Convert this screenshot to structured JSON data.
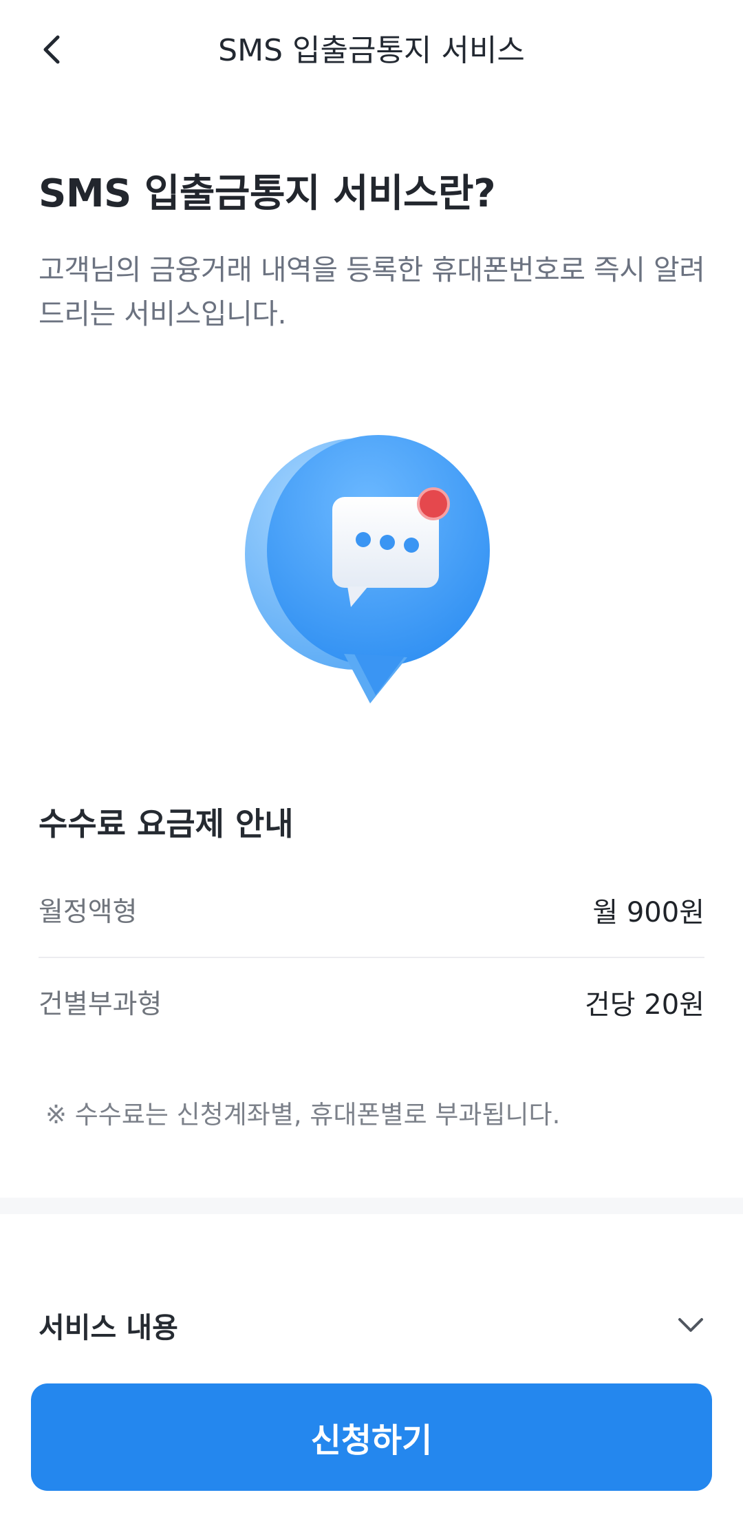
{
  "header": {
    "title": "SMS 입출금통지 서비스",
    "back_icon": "chevron-left-icon"
  },
  "hero": {
    "title": "SMS 입출금통지 서비스란?",
    "description": "고객님의 금융거래 내역을 등록한 휴대폰번호로 즉시 알려드리는 서비스입니다.",
    "illustration_icon": "chat-bubble-notification-icon"
  },
  "fees": {
    "title": "수수료 요금제 안내",
    "rows": [
      {
        "label": "월정액형",
        "value": "월 900원"
      },
      {
        "label": "건별부과형",
        "value": "건당 20원"
      }
    ],
    "note": "※ 수수료는 신청계좌별, 휴대폰별로 부과됩니다."
  },
  "service": {
    "label": "서비스 내용",
    "icon": "chevron-down-icon"
  },
  "apply_button": {
    "label": "신청하기"
  },
  "colors": {
    "primary": "#2487ee",
    "notification_dot": "#e5484d",
    "bubble_blue": "#4aa3f7"
  }
}
